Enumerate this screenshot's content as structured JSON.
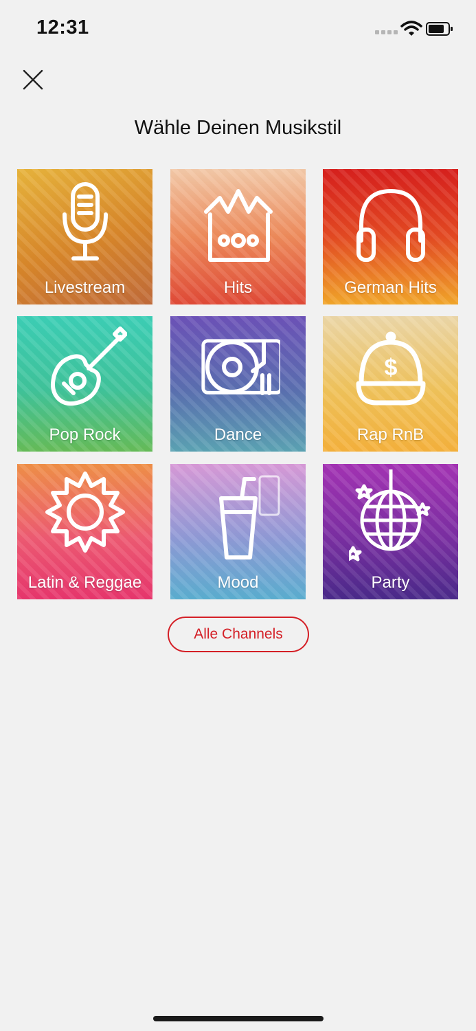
{
  "status_bar": {
    "time": "12:31"
  },
  "page": {
    "title": "Wähle Deinen Musikstil"
  },
  "tiles": [
    {
      "label": "Livestream"
    },
    {
      "label": "Hits"
    },
    {
      "label": "German Hits"
    },
    {
      "label": "Pop Rock"
    },
    {
      "label": "Dance"
    },
    {
      "label": "Rap RnB"
    },
    {
      "label": "Latin & Reggae"
    },
    {
      "label": "Mood"
    },
    {
      "label": "Party"
    }
  ],
  "icons": [
    "microphone-icon",
    "crown-icon",
    "headphones-icon",
    "guitar-icon",
    "turntable-icon",
    "cap-icon",
    "sun-icon",
    "drink-icon",
    "disco-ball-icon"
  ],
  "all_channels_button": {
    "label": "Alle Channels"
  },
  "colors": {
    "accent": "#d41f26",
    "background": "#f1f1f1"
  }
}
